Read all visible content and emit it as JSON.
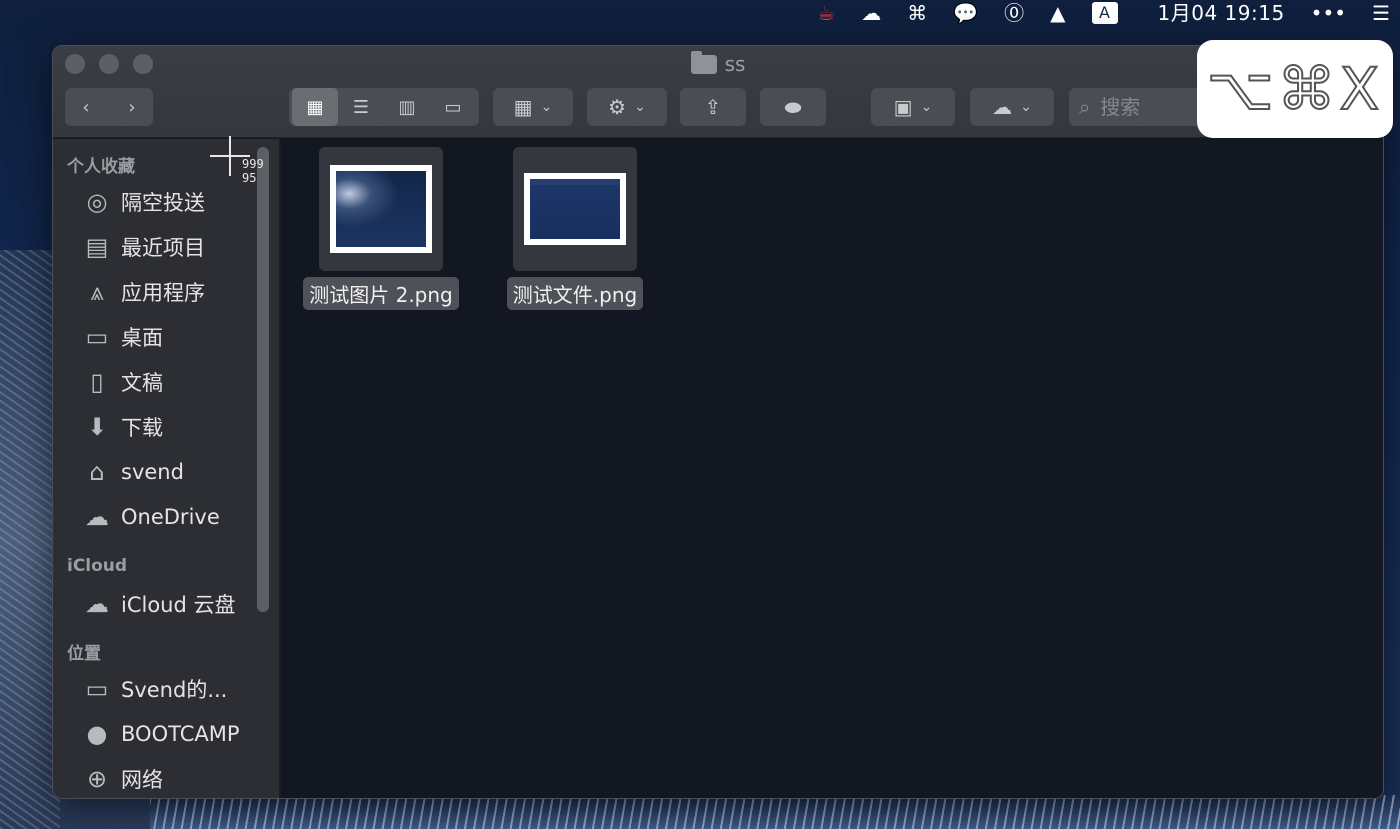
{
  "menubar": {
    "icons": [
      "coffee-icon",
      "ghost-icon",
      "command-icon",
      "wechat-icon",
      "onepassword-icon",
      "script-icon",
      "input-source-icon"
    ],
    "input_source": "A",
    "clock": "1月04 19:15",
    "more": "•••",
    "notification_center": "☰"
  },
  "window": {
    "title": "ss",
    "search_placeholder": "搜索"
  },
  "sidebar": {
    "favorites_header": "个人收藏",
    "favorites": [
      {
        "label": "隔空投送",
        "icon": "airdrop-icon"
      },
      {
        "label": "最近项目",
        "icon": "recents-icon"
      },
      {
        "label": "应用程序",
        "icon": "applications-icon"
      },
      {
        "label": "桌面",
        "icon": "desktop-icon"
      },
      {
        "label": "文稿",
        "icon": "documents-icon"
      },
      {
        "label": "下载",
        "icon": "downloads-icon"
      },
      {
        "label": "svend",
        "icon": "home-icon"
      },
      {
        "label": "OneDrive",
        "icon": "cloud-icon"
      }
    ],
    "icloud_header": "iCloud",
    "icloud": [
      {
        "label": "iCloud 云盘",
        "icon": "icloud-icon"
      }
    ],
    "locations_header": "位置",
    "locations": [
      {
        "label": "Svend的...",
        "icon": "laptop-icon"
      },
      {
        "label": "BOOTCAMP",
        "icon": "disk-icon"
      },
      {
        "label": "网络",
        "icon": "network-icon"
      }
    ]
  },
  "files": [
    {
      "name": "测试图片 2.png"
    },
    {
      "name": "测试文件.png"
    }
  ],
  "overlay": {
    "keystroke": "⌥⌘X",
    "coords_x": "999",
    "coords_y": "95"
  }
}
